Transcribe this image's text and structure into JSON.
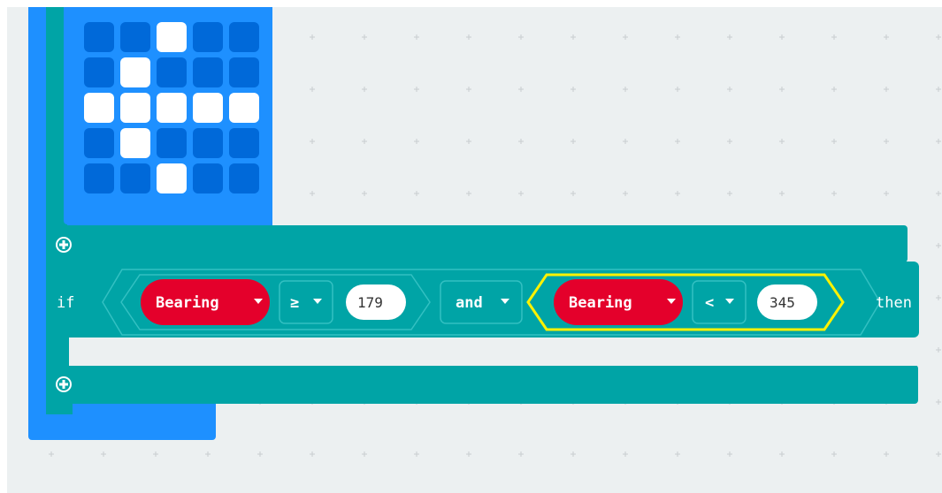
{
  "colors": {
    "workspace_bg": "#ecf0f1",
    "basic_block": "#1e90ff",
    "basic_block_edge": "#1a7be0",
    "led_off": "#0069d9",
    "led_on": "#ffffff",
    "logic_block": "#00a4a6",
    "logic_block_dark": "#008a8c",
    "input_block": "#e3008c",
    "bearing_red": "#e4002b",
    "highlight": "#fff200"
  },
  "led_matrix": [
    [
      0,
      0,
      1,
      0,
      0
    ],
    [
      0,
      1,
      0,
      0,
      0
    ],
    [
      1,
      1,
      1,
      1,
      1
    ],
    [
      0,
      1,
      0,
      0,
      0
    ],
    [
      0,
      0,
      1,
      0,
      0
    ]
  ],
  "if_block": {
    "if_label": "if",
    "then_label": "then",
    "left_condition": {
      "variable": "Bearing",
      "operator": "≥",
      "value": "179"
    },
    "logic_operator": "and",
    "right_condition": {
      "variable": "Bearing",
      "operator": "<",
      "value": "345"
    }
  },
  "icons": {
    "add": "plus-circle-icon",
    "dropdown": "caret-down-icon"
  }
}
